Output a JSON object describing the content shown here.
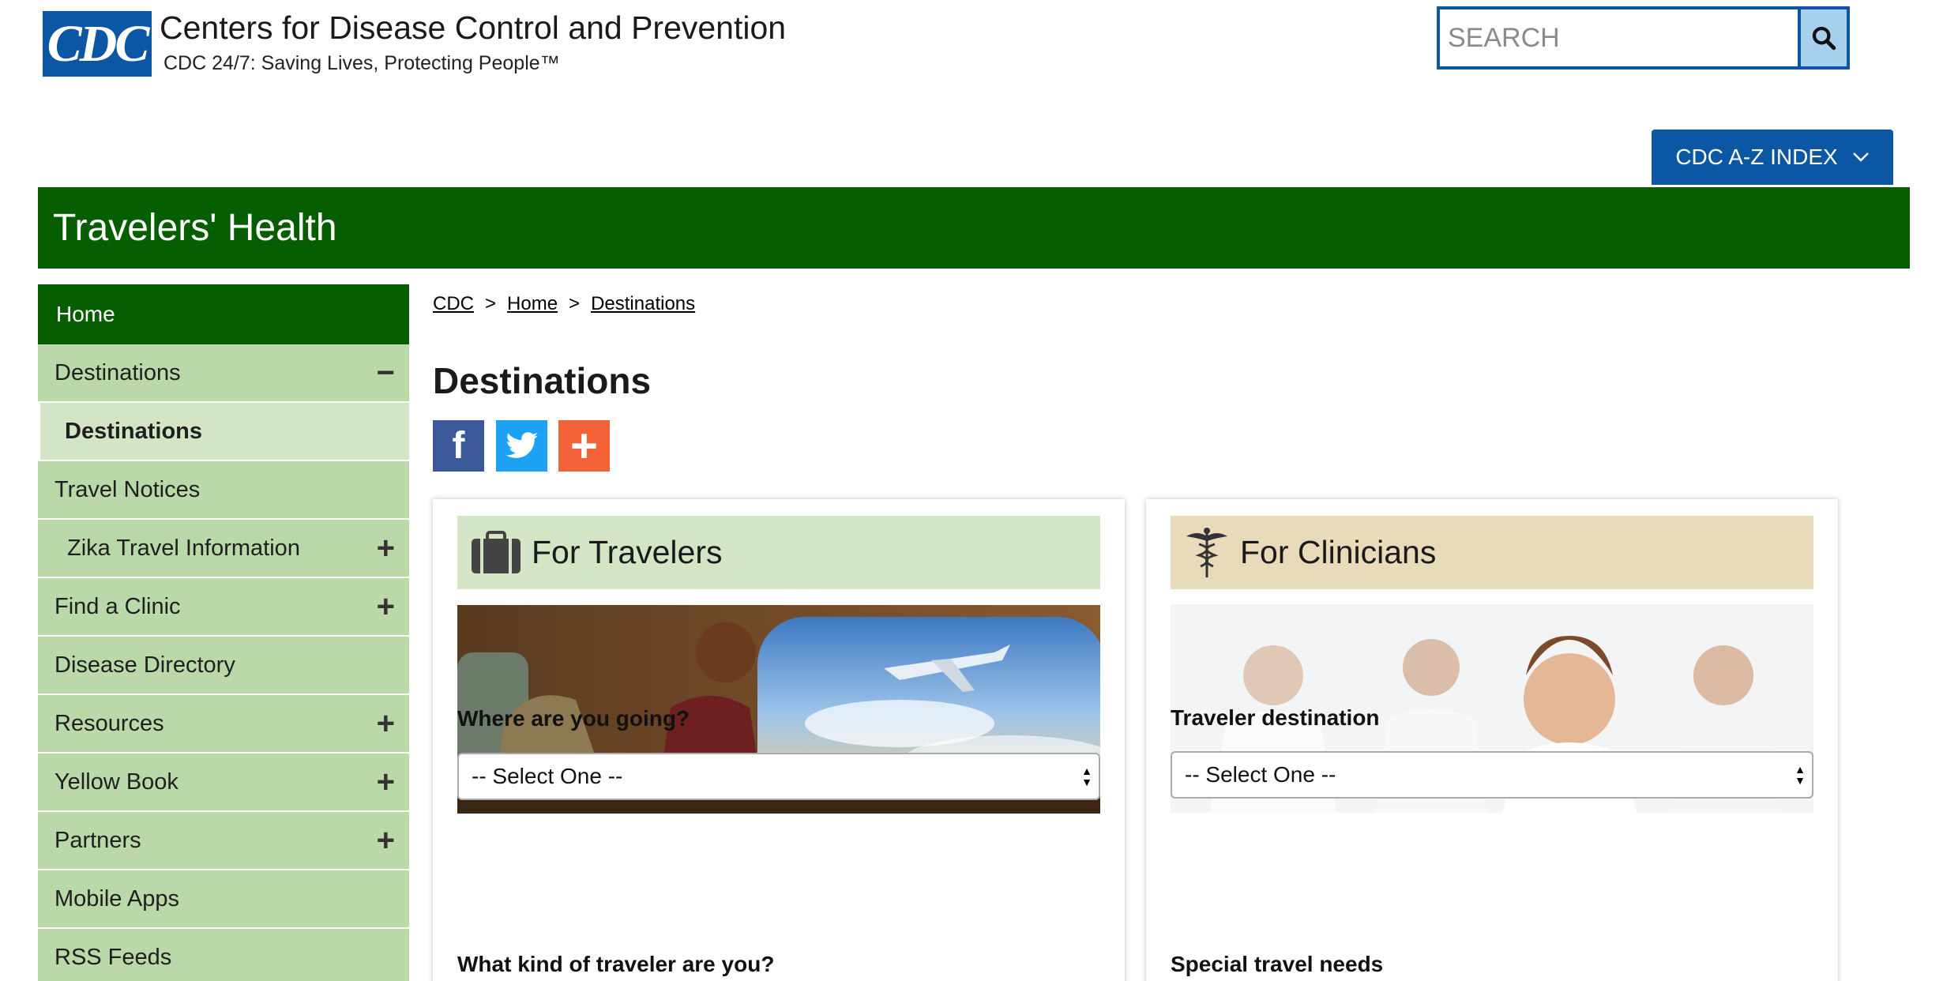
{
  "header": {
    "logo_text": "CDC",
    "title": "Centers for Disease Control and Prevention",
    "tagline": "CDC 24/7: Saving Lives, Protecting People™",
    "search_placeholder": "SEARCH",
    "az_index_label": "CDC A-Z INDEX"
  },
  "banner": {
    "title": "Travelers' Health"
  },
  "sidebar": {
    "items": [
      {
        "label": "Home",
        "sign": ""
      },
      {
        "label": "Destinations",
        "sign": "−"
      },
      {
        "label": "Destinations",
        "sign": ""
      },
      {
        "label": "Travel Notices",
        "sign": ""
      },
      {
        "label": "Zika Travel Information",
        "sign": "+"
      },
      {
        "label": "Find a Clinic",
        "sign": "+"
      },
      {
        "label": "Disease Directory",
        "sign": ""
      },
      {
        "label": "Resources",
        "sign": "+"
      },
      {
        "label": "Yellow Book",
        "sign": "+"
      },
      {
        "label": "Partners",
        "sign": "+"
      },
      {
        "label": "Mobile Apps",
        "sign": ""
      },
      {
        "label": "RSS Feeds",
        "sign": ""
      }
    ]
  },
  "breadcrumb": {
    "items": [
      "CDC",
      "Home",
      "Destinations"
    ],
    "separator": ">"
  },
  "main": {
    "title": "Destinations",
    "social": {
      "facebook": "f",
      "plus": "+"
    },
    "travelers_card": {
      "title": "For Travelers",
      "q1": "Where are you going?",
      "select1": "-- Select One --",
      "q2": "What kind of traveler are you?"
    },
    "clinicians_card": {
      "title": "For Clinicians",
      "q1": "Traveler destination",
      "select1": "-- Select One --",
      "q2": "Special travel needs"
    }
  },
  "colors": {
    "cdc_blue": "#0b57a4",
    "banner_green": "#075e00",
    "nav_green": "#bad8a8",
    "travelers_header": "#d3e5c5",
    "clinicians_header": "#e8dbba"
  }
}
